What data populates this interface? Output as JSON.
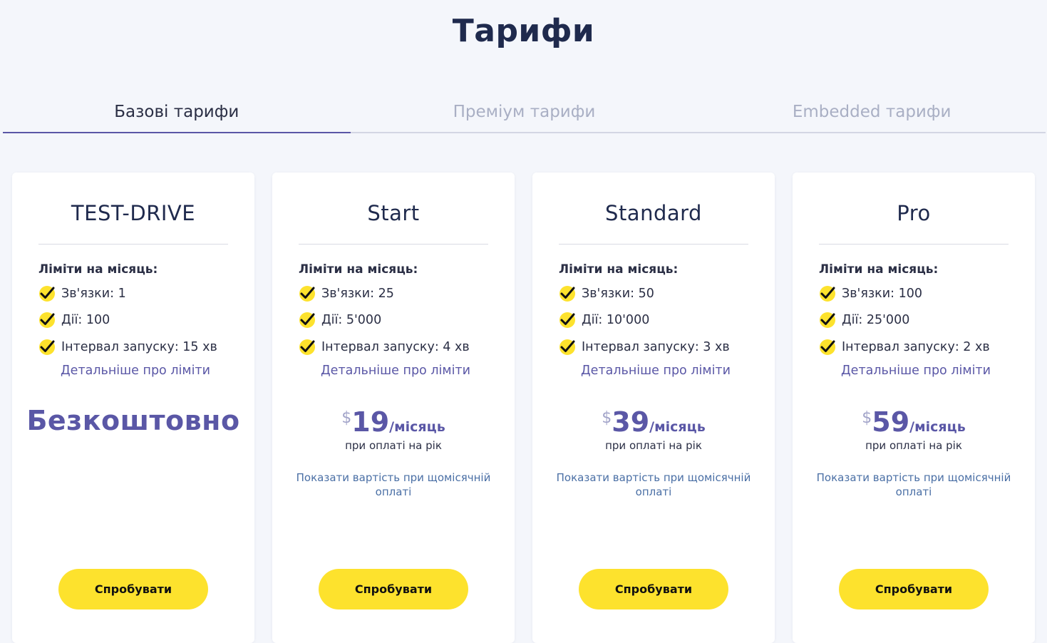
{
  "page": {
    "title": "Тарифи"
  },
  "tabs": [
    {
      "label": "Базові тарифи",
      "active": true
    },
    {
      "label": "Преміум тарифи",
      "active": false
    },
    {
      "label": "Embedded тарифи",
      "active": false
    }
  ],
  "colors": {
    "accent": "#5a57a6",
    "button": "#fde22d",
    "check": "#fde22d",
    "link": "#4a6fa5"
  },
  "plans": [
    {
      "name": "TEST-DRIVE",
      "limits_title": "Ліміти на місяць:",
      "limits": [
        "Зв'язки: 1",
        "Дії: 100",
        "Інтервал запуску: 15 хв"
      ],
      "more_link": "Детальніше про ліміти",
      "free_label": "Безкоштовно",
      "button": "Спробувати"
    },
    {
      "name": "Start",
      "limits_title": "Ліміти на місяць:",
      "limits": [
        "Зв'язки: 25",
        "Дії: 5'000",
        "Інтервал запуску: 4 хв"
      ],
      "more_link": "Детальніше про ліміти",
      "currency": "$",
      "price": "19",
      "period": "/місяць",
      "price_note": "при оплаті на рік",
      "monthly_link": "Показати вартість при щомісячній оплаті",
      "button": "Спробувати"
    },
    {
      "name": "Standard",
      "limits_title": "Ліміти на місяць:",
      "limits": [
        "Зв'язки: 50",
        "Дії: 10'000",
        "Інтервал запуску: 3 хв"
      ],
      "more_link": "Детальніше про ліміти",
      "currency": "$",
      "price": "39",
      "period": "/місяць",
      "price_note": "при оплаті на рік",
      "monthly_link": "Показати вартість при щомісячній оплаті",
      "button": "Спробувати"
    },
    {
      "name": "Pro",
      "limits_title": "Ліміти на місяць:",
      "limits": [
        "Зв'язки: 100",
        "Дії: 25'000",
        "Інтервал запуску: 2 хв"
      ],
      "more_link": "Детальніше про ліміти",
      "currency": "$",
      "price": "59",
      "period": "/місяць",
      "price_note": "при оплаті на рік",
      "monthly_link": "Показати вартість при щомісячній оплаті",
      "button": "Спробувати"
    }
  ]
}
